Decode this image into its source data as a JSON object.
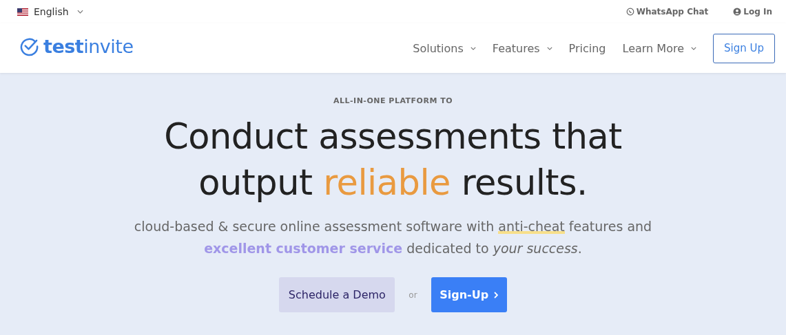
{
  "topbar": {
    "language": "English",
    "links": [
      {
        "label": "WhatsApp Chat",
        "kind": "whatsapp"
      },
      {
        "label": "Log In",
        "kind": "user"
      }
    ]
  },
  "header": {
    "logo": "**test**invite",
    "nav": [
      {
        "label": "Solutions",
        "dropdown": true
      },
      {
        "label": "Features",
        "dropdown": true
      },
      {
        "label": "Pricing",
        "dropdown": false
      },
      {
        "label": "Learn More",
        "dropdown": true
      }
    ],
    "signup": "Sign Up"
  },
  "hero": {
    "eyebrow": "ALL-IN-ONE PLATFORM TO",
    "headline_lines": [
      "Conduct assessments that",
      "output **reliable** results."
    ],
    "subtitle": [
      {
        "kind": "plain",
        "text": "cloud-based & secure online assessment software with "
      },
      {
        "kind": "marker",
        "text": "anti-cheat"
      },
      {
        "kind": "plain",
        "text": " features and "
      },
      {
        "kind": "accent",
        "text": "excellent customer service"
      },
      {
        "kind": "plain",
        "text": " dedicated to "
      },
      {
        "kind": "italic",
        "text": "your success"
      },
      {
        "kind": "plain",
        "text": "."
      }
    ],
    "demo_button": "Schedule a Demo",
    "or": "or",
    "signup_button": "Sign-Up"
  }
}
